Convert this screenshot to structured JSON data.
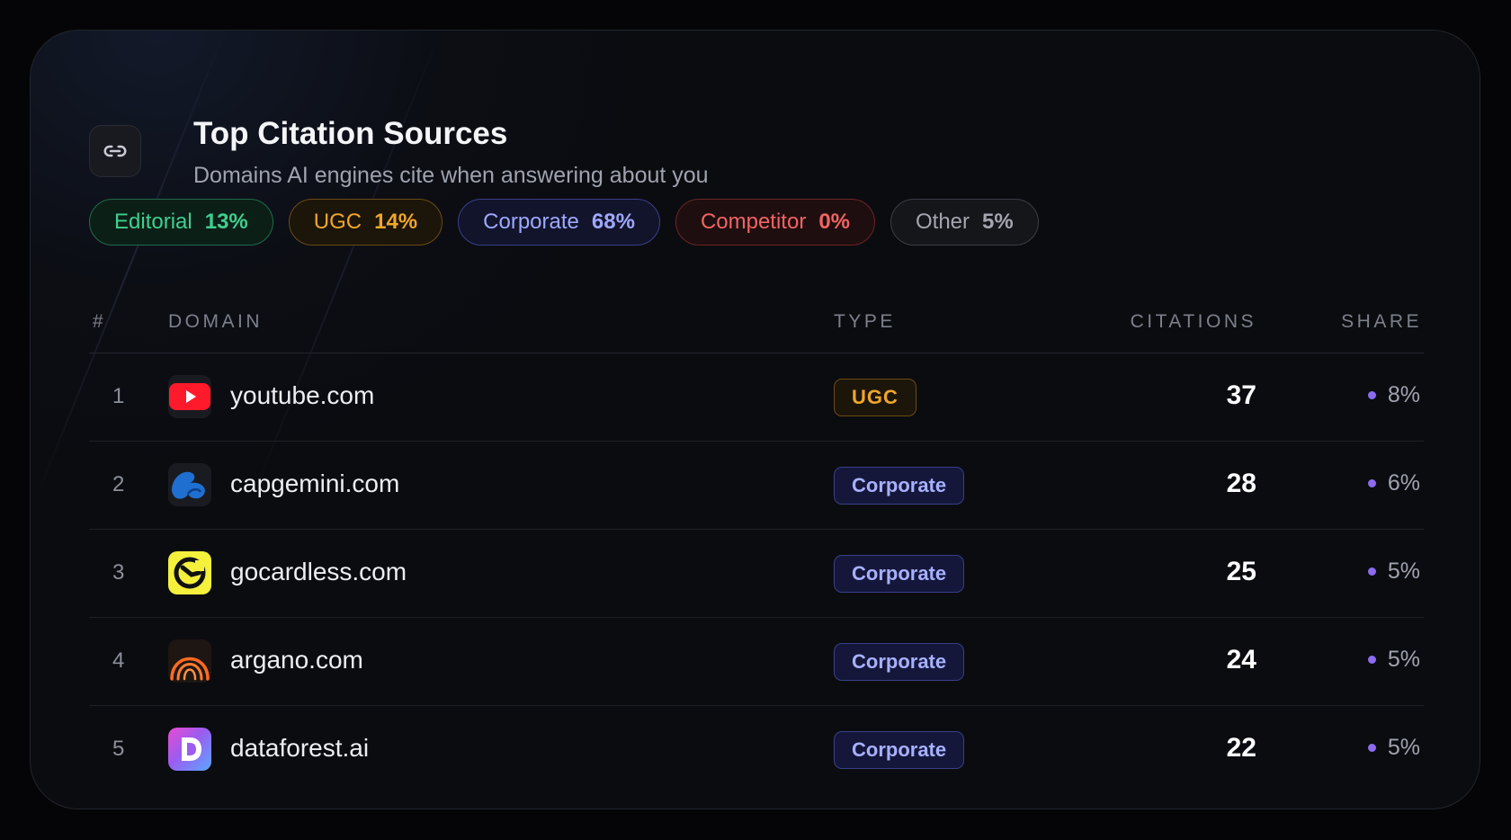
{
  "header": {
    "title": "Top Citation Sources",
    "subtitle": "Domains AI engines cite when answering about you",
    "icon": "link-icon"
  },
  "summary": [
    {
      "label": "Editorial",
      "value": "13%",
      "color": "#3fcf8e"
    },
    {
      "label": "UGC",
      "value": "14%",
      "color": "#f0a62a"
    },
    {
      "label": "Corporate",
      "value": "68%",
      "color": "#9ea8ff"
    },
    {
      "label": "Competitor",
      "value": "0%",
      "color": "#f06464"
    },
    {
      "label": "Other",
      "value": "5%",
      "color": "#a3a6ae"
    }
  ],
  "table": {
    "columns": [
      "#",
      "DOMAIN",
      "TYPE",
      "CITATIONS",
      "SHARE"
    ],
    "rows": [
      {
        "rank": "1",
        "domain": "youtube.com",
        "icon": "youtube-icon",
        "type": "UGC",
        "citations": "37",
        "share": "8%"
      },
      {
        "rank": "2",
        "domain": "capgemini.com",
        "icon": "capgemini-icon",
        "type": "Corporate",
        "citations": "28",
        "share": "6%"
      },
      {
        "rank": "3",
        "domain": "gocardless.com",
        "icon": "gocardless-icon",
        "type": "Corporate",
        "citations": "25",
        "share": "5%"
      },
      {
        "rank": "4",
        "domain": "argano.com",
        "icon": "argano-icon",
        "type": "Corporate",
        "citations": "24",
        "share": "5%"
      },
      {
        "rank": "5",
        "domain": "dataforest.ai",
        "icon": "dataforest-icon",
        "type": "Corporate",
        "citations": "22",
        "share": "5%"
      }
    ]
  },
  "colors": {
    "share_dot": "#8b6cf0",
    "card_bg": "#0b0c10"
  }
}
